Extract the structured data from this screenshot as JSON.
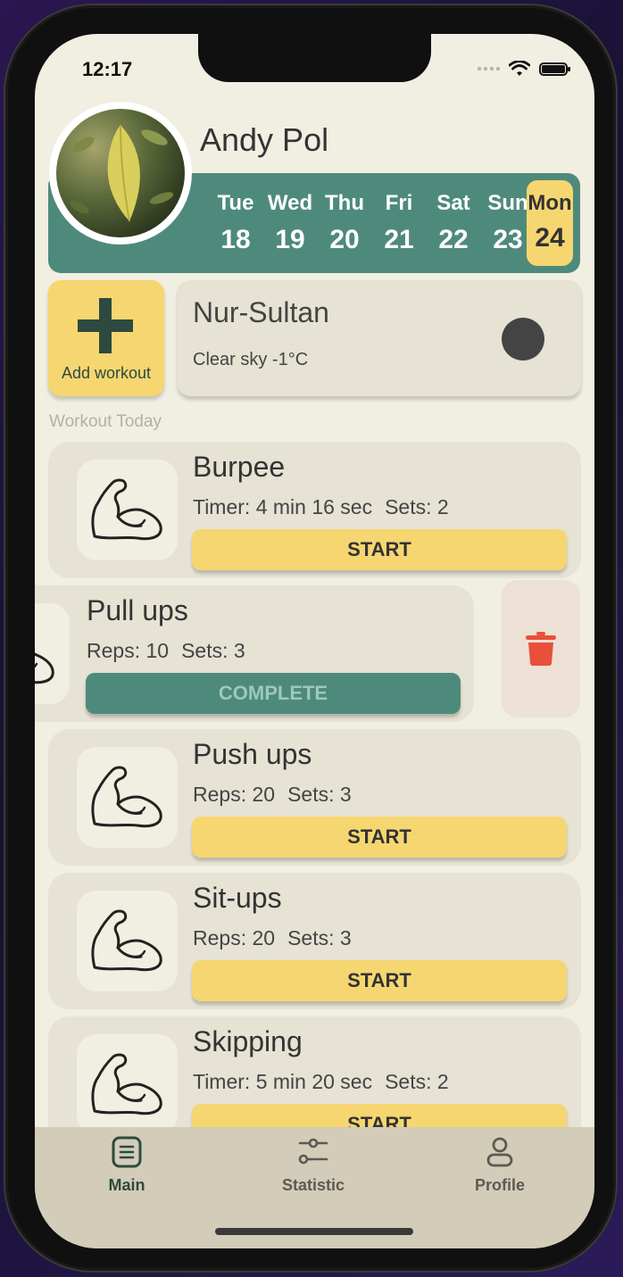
{
  "status_bar": {
    "time": "12:17"
  },
  "profile": {
    "name": "Andy Pol"
  },
  "week": [
    {
      "day": "Tue",
      "date": "18"
    },
    {
      "day": "Wed",
      "date": "19"
    },
    {
      "day": "Thu",
      "date": "20"
    },
    {
      "day": "Fri",
      "date": "21"
    },
    {
      "day": "Sat",
      "date": "22"
    },
    {
      "day": "Sun",
      "date": "23"
    },
    {
      "day": "Mon",
      "date": "24",
      "selected": true
    }
  ],
  "add_workout": {
    "label": "Add workout"
  },
  "weather": {
    "city": "Nur-Sultan",
    "description": "Clear sky -1°C"
  },
  "section_title": "Workout Today",
  "workouts": [
    {
      "name": "Burpee",
      "info1": "Timer: 4 min 16 sec",
      "info2": "Sets: 2",
      "action": "START"
    },
    {
      "name": "Pull ups",
      "info1": "Reps: 10",
      "info2": "Sets: 3",
      "action": "COMPLETE"
    },
    {
      "name": "Push ups",
      "info1": "Reps: 20",
      "info2": "Sets: 3",
      "action": "START"
    },
    {
      "name": "Sit-ups",
      "info1": "Reps: 20",
      "info2": "Sets: 3",
      "action": "START"
    },
    {
      "name": "Skipping",
      "info1": "Timer: 5 min 20 sec",
      "info2": "Sets: 2",
      "action": "START"
    }
  ],
  "tabs": [
    {
      "label": "Main",
      "icon": "document-list-icon",
      "active": true
    },
    {
      "label": "Statistic",
      "icon": "sliders-icon",
      "active": false
    },
    {
      "label": "Profile",
      "icon": "person-icon",
      "active": false
    }
  ],
  "colors": {
    "background": "#F1EEE2",
    "card": "#E6E2D4",
    "accent_green": "#4E8A7B",
    "accent_yellow": "#F6D670",
    "delete_red": "#E8503C",
    "tabbar": "#D3CCB8"
  }
}
